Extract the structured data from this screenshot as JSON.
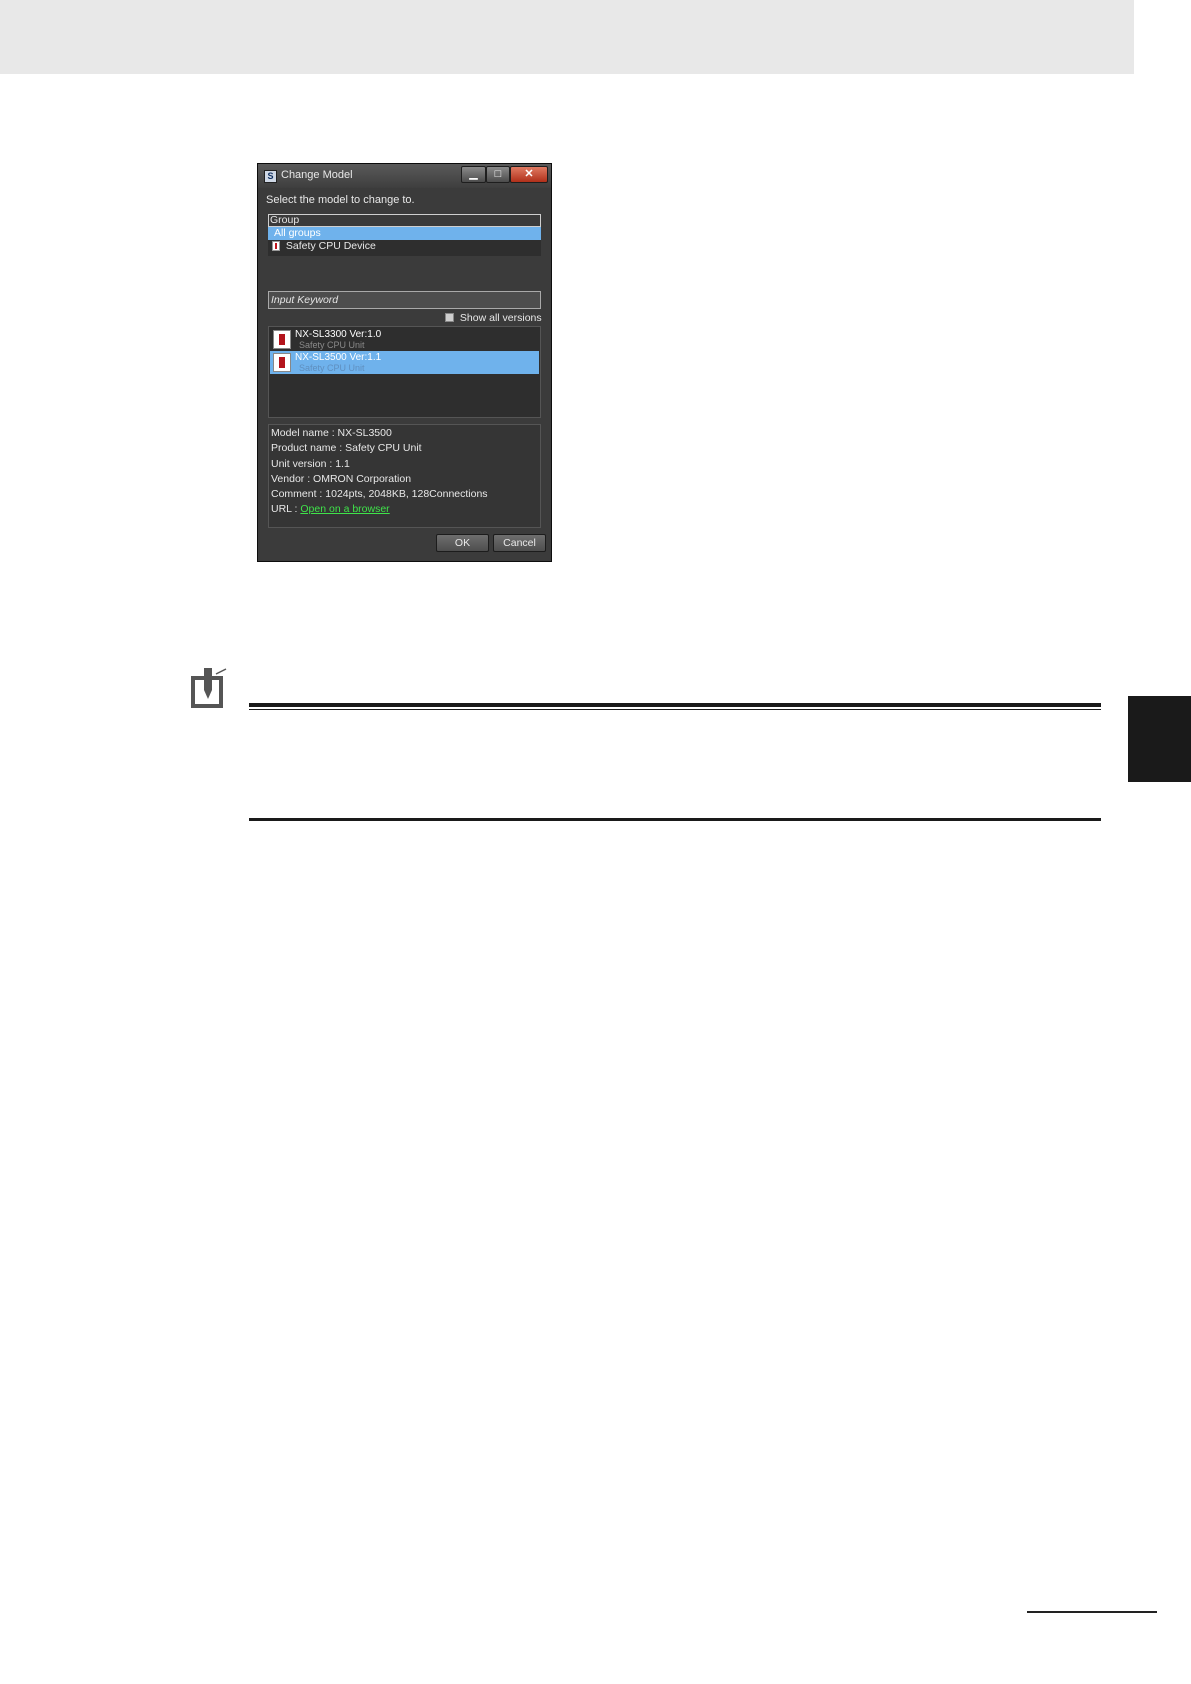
{
  "dialog": {
    "title": "Change Model",
    "window_buttons": {
      "minimize": "▁",
      "maximize": "□",
      "close": "✕"
    },
    "prompt": "Select the model to change to.",
    "group_header": "Group",
    "groups": [
      "All groups",
      "Safety CPU Device"
    ],
    "keyword_placeholder": "Input Keyword",
    "show_all_label": "Show all versions",
    "models": [
      {
        "name": "NX-SL3300 Ver:1.0",
        "sub": "Safety CPU Unit"
      },
      {
        "name": "NX-SL3500 Ver:1.1",
        "sub": "Safety CPU Unit"
      }
    ],
    "details": {
      "model_name": "Model name : NX-SL3500",
      "product_name": "Product name : Safety CPU Unit",
      "unit_version": "Unit version : 1.1",
      "vendor": "Vendor :  OMRON Corporation",
      "comment": "Comment : 1024pts, 2048KB, 128Connections",
      "url_label": "URL : ",
      "url_link": "Open on a browser"
    },
    "ok_label": "OK",
    "cancel_label": "Cancel"
  },
  "colors": {
    "selection": "#6fb2ec",
    "link": "#3fe34a",
    "dialog_bg": "#3b3b3b"
  },
  "icons": {
    "precautions": "precautions-pencil-icon",
    "unit": "safety-cpu-unit-icon"
  }
}
